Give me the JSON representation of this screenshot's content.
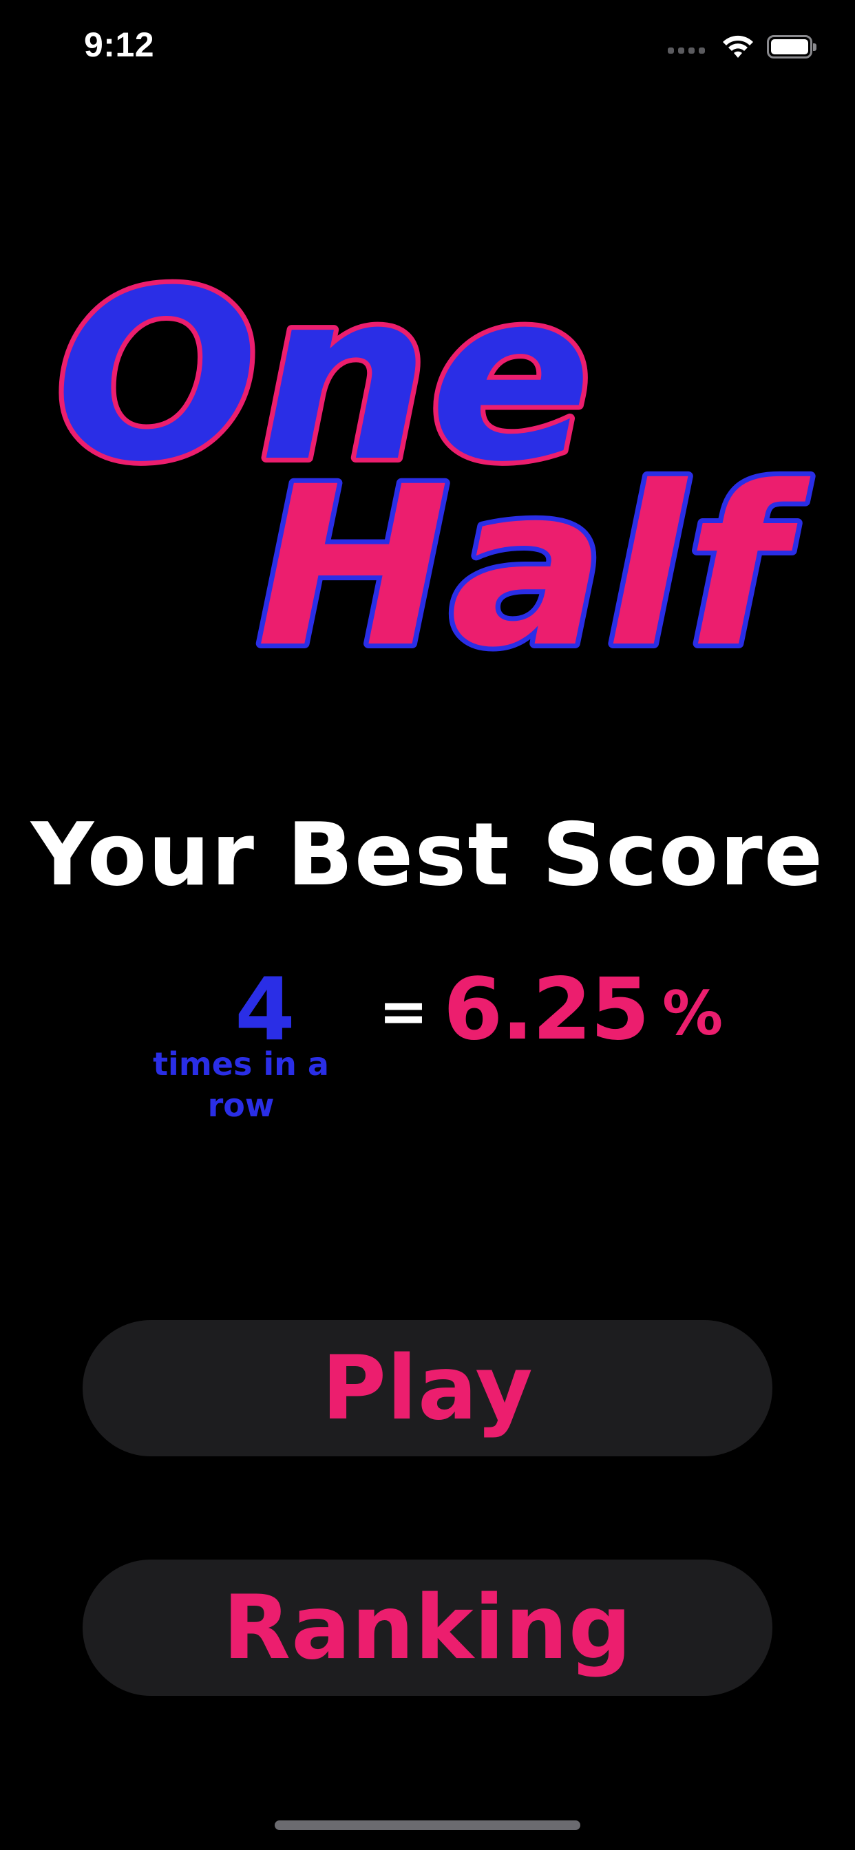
{
  "status_bar": {
    "time": "9:12",
    "icons": [
      "cellular-signal-icon",
      "wifi-icon",
      "battery-icon"
    ]
  },
  "logo": {
    "word_one": "One",
    "word_two": "Half",
    "colors": {
      "blue": "#2a2ee6",
      "pink": "#ec1e6e"
    }
  },
  "best_score": {
    "title": "Your Best Score",
    "count": "4",
    "count_label": "times in a row",
    "equals": "=",
    "percent_value": "6.25",
    "percent_sign": "%"
  },
  "menu": {
    "play_label": "Play",
    "ranking_label": "Ranking"
  },
  "theme": {
    "background": "#000000",
    "button_background": "#1d1d1f",
    "accent_pink": "#ec1e6e",
    "accent_blue": "#2a2ee6",
    "text_white": "#ffffff"
  }
}
